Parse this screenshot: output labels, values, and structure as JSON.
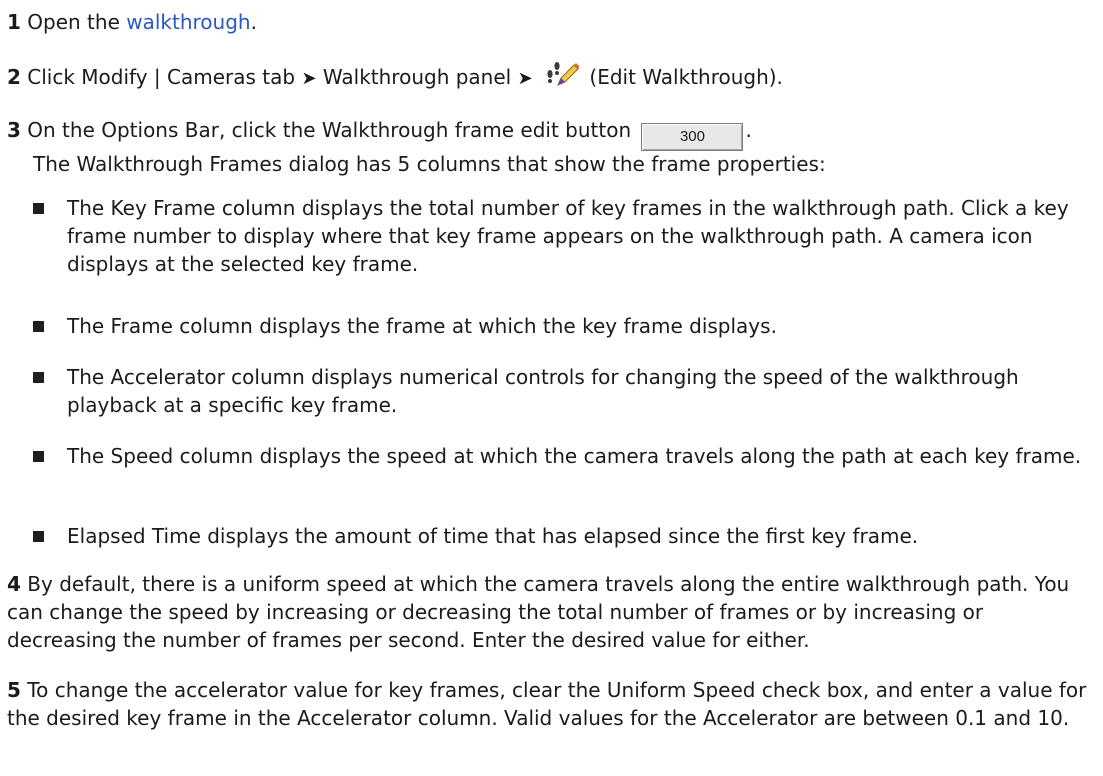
{
  "steps": {
    "s1": {
      "num": "1",
      "pre": "Open the",
      "link": "walkthrough",
      "post": "."
    },
    "s2": {
      "num": "2",
      "pre": "Click Modify | Cameras tab",
      "sep1": "➤",
      "mid": "Walkthrough panel",
      "sep2": "➤",
      "icon": "edit-walkthrough-icon",
      "post": "(Edit Walkthrough)."
    },
    "s3": {
      "num": "3",
      "pre": "On the Options Bar, click the Walkthrough frame edit button",
      "button_value": "300",
      "post": ".",
      "intro": "The Walkthrough Frames dialog has 5 columns that show the frame properties:"
    },
    "bullets": [
      "The Key Frame column displays the total number of key frames in the walkthrough path. Click a key frame number to display where that key frame appears on the walkthrough path. A camera icon displays at the selected key frame.",
      "The Frame column displays the frame at which the key frame displays.",
      "The Accelerator column displays numerical controls for changing the speed of the walkthrough playback at a specific key frame.",
      "The Speed column displays the speed at which the camera travels along the path at each key frame.",
      "Elapsed Time displays the amount of time that has elapsed since the first key frame."
    ],
    "s4": {
      "num": "4",
      "text": "By default, there is a uniform speed at which the camera travels along the entire walkthrough path. You can change the speed by increasing or decreasing the total number of frames or by increasing or decreasing the number of frames per second. Enter the desired value for either."
    },
    "s5": {
      "num": "5",
      "text": "To change the accelerator value for key frames, clear the Uniform Speed check box, and enter a value for the desired key frame in the Accelerator column. Valid values for the Accelerator are between 0.1 and 10."
    }
  },
  "colors": {
    "link": "#2a56c6",
    "text": "#1b1b1b",
    "bullet": "#1f1f1f"
  }
}
